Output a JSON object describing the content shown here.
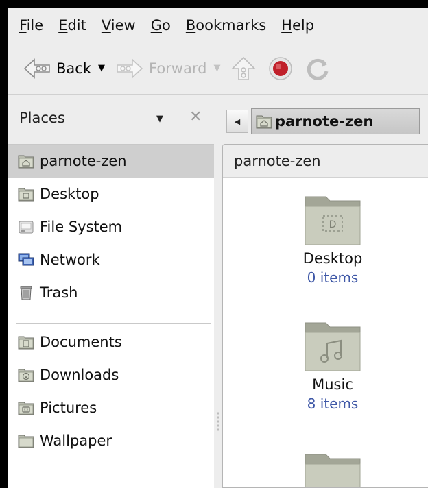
{
  "menubar": {
    "items": [
      {
        "mnemonic": "F",
        "rest": "ile"
      },
      {
        "mnemonic": "E",
        "rest": "dit"
      },
      {
        "mnemonic": "V",
        "rest": "iew"
      },
      {
        "mnemonic": "G",
        "rest": "o"
      },
      {
        "mnemonic": "B",
        "rest": "ookmarks"
      },
      {
        "mnemonic": "H",
        "rest": "elp"
      }
    ]
  },
  "toolbar": {
    "back_label": "Back",
    "forward_label": "Forward",
    "back_icon": "back-arrow-icon",
    "forward_icon": "forward-arrow-icon",
    "up_icon": "up-arrow-icon",
    "stop_icon": "stop-icon",
    "reload_icon": "reload-icon"
  },
  "location": {
    "places_label": "Places",
    "breadcrumb_current": "parnote-zen"
  },
  "sidebar": {
    "places": [
      {
        "label": "parnote-zen",
        "icon": "home-folder-icon",
        "selected": true
      },
      {
        "label": "Desktop",
        "icon": "desktop-folder-icon"
      },
      {
        "label": "File System",
        "icon": "drive-icon"
      },
      {
        "label": "Network",
        "icon": "network-icon"
      },
      {
        "label": "Trash",
        "icon": "trash-icon"
      }
    ],
    "bookmarks": [
      {
        "label": "Documents",
        "icon": "documents-folder-icon"
      },
      {
        "label": "Downloads",
        "icon": "downloads-folder-icon"
      },
      {
        "label": "Pictures",
        "icon": "pictures-folder-icon"
      },
      {
        "label": "Wallpaper",
        "icon": "folder-icon"
      }
    ]
  },
  "main": {
    "tab_label": "parnote-zen",
    "items": [
      {
        "name": "Desktop",
        "count": "0 items",
        "icon": "desktop-folder-icon"
      },
      {
        "name": "Music",
        "count": "8 items",
        "icon": "music-folder-icon"
      },
      {
        "name": "",
        "count": "",
        "icon": "folder-icon"
      }
    ]
  },
  "colors": {
    "item_count": "#3f58a7",
    "selection": "#cfcfcf",
    "stop_red": "#c0202a"
  }
}
